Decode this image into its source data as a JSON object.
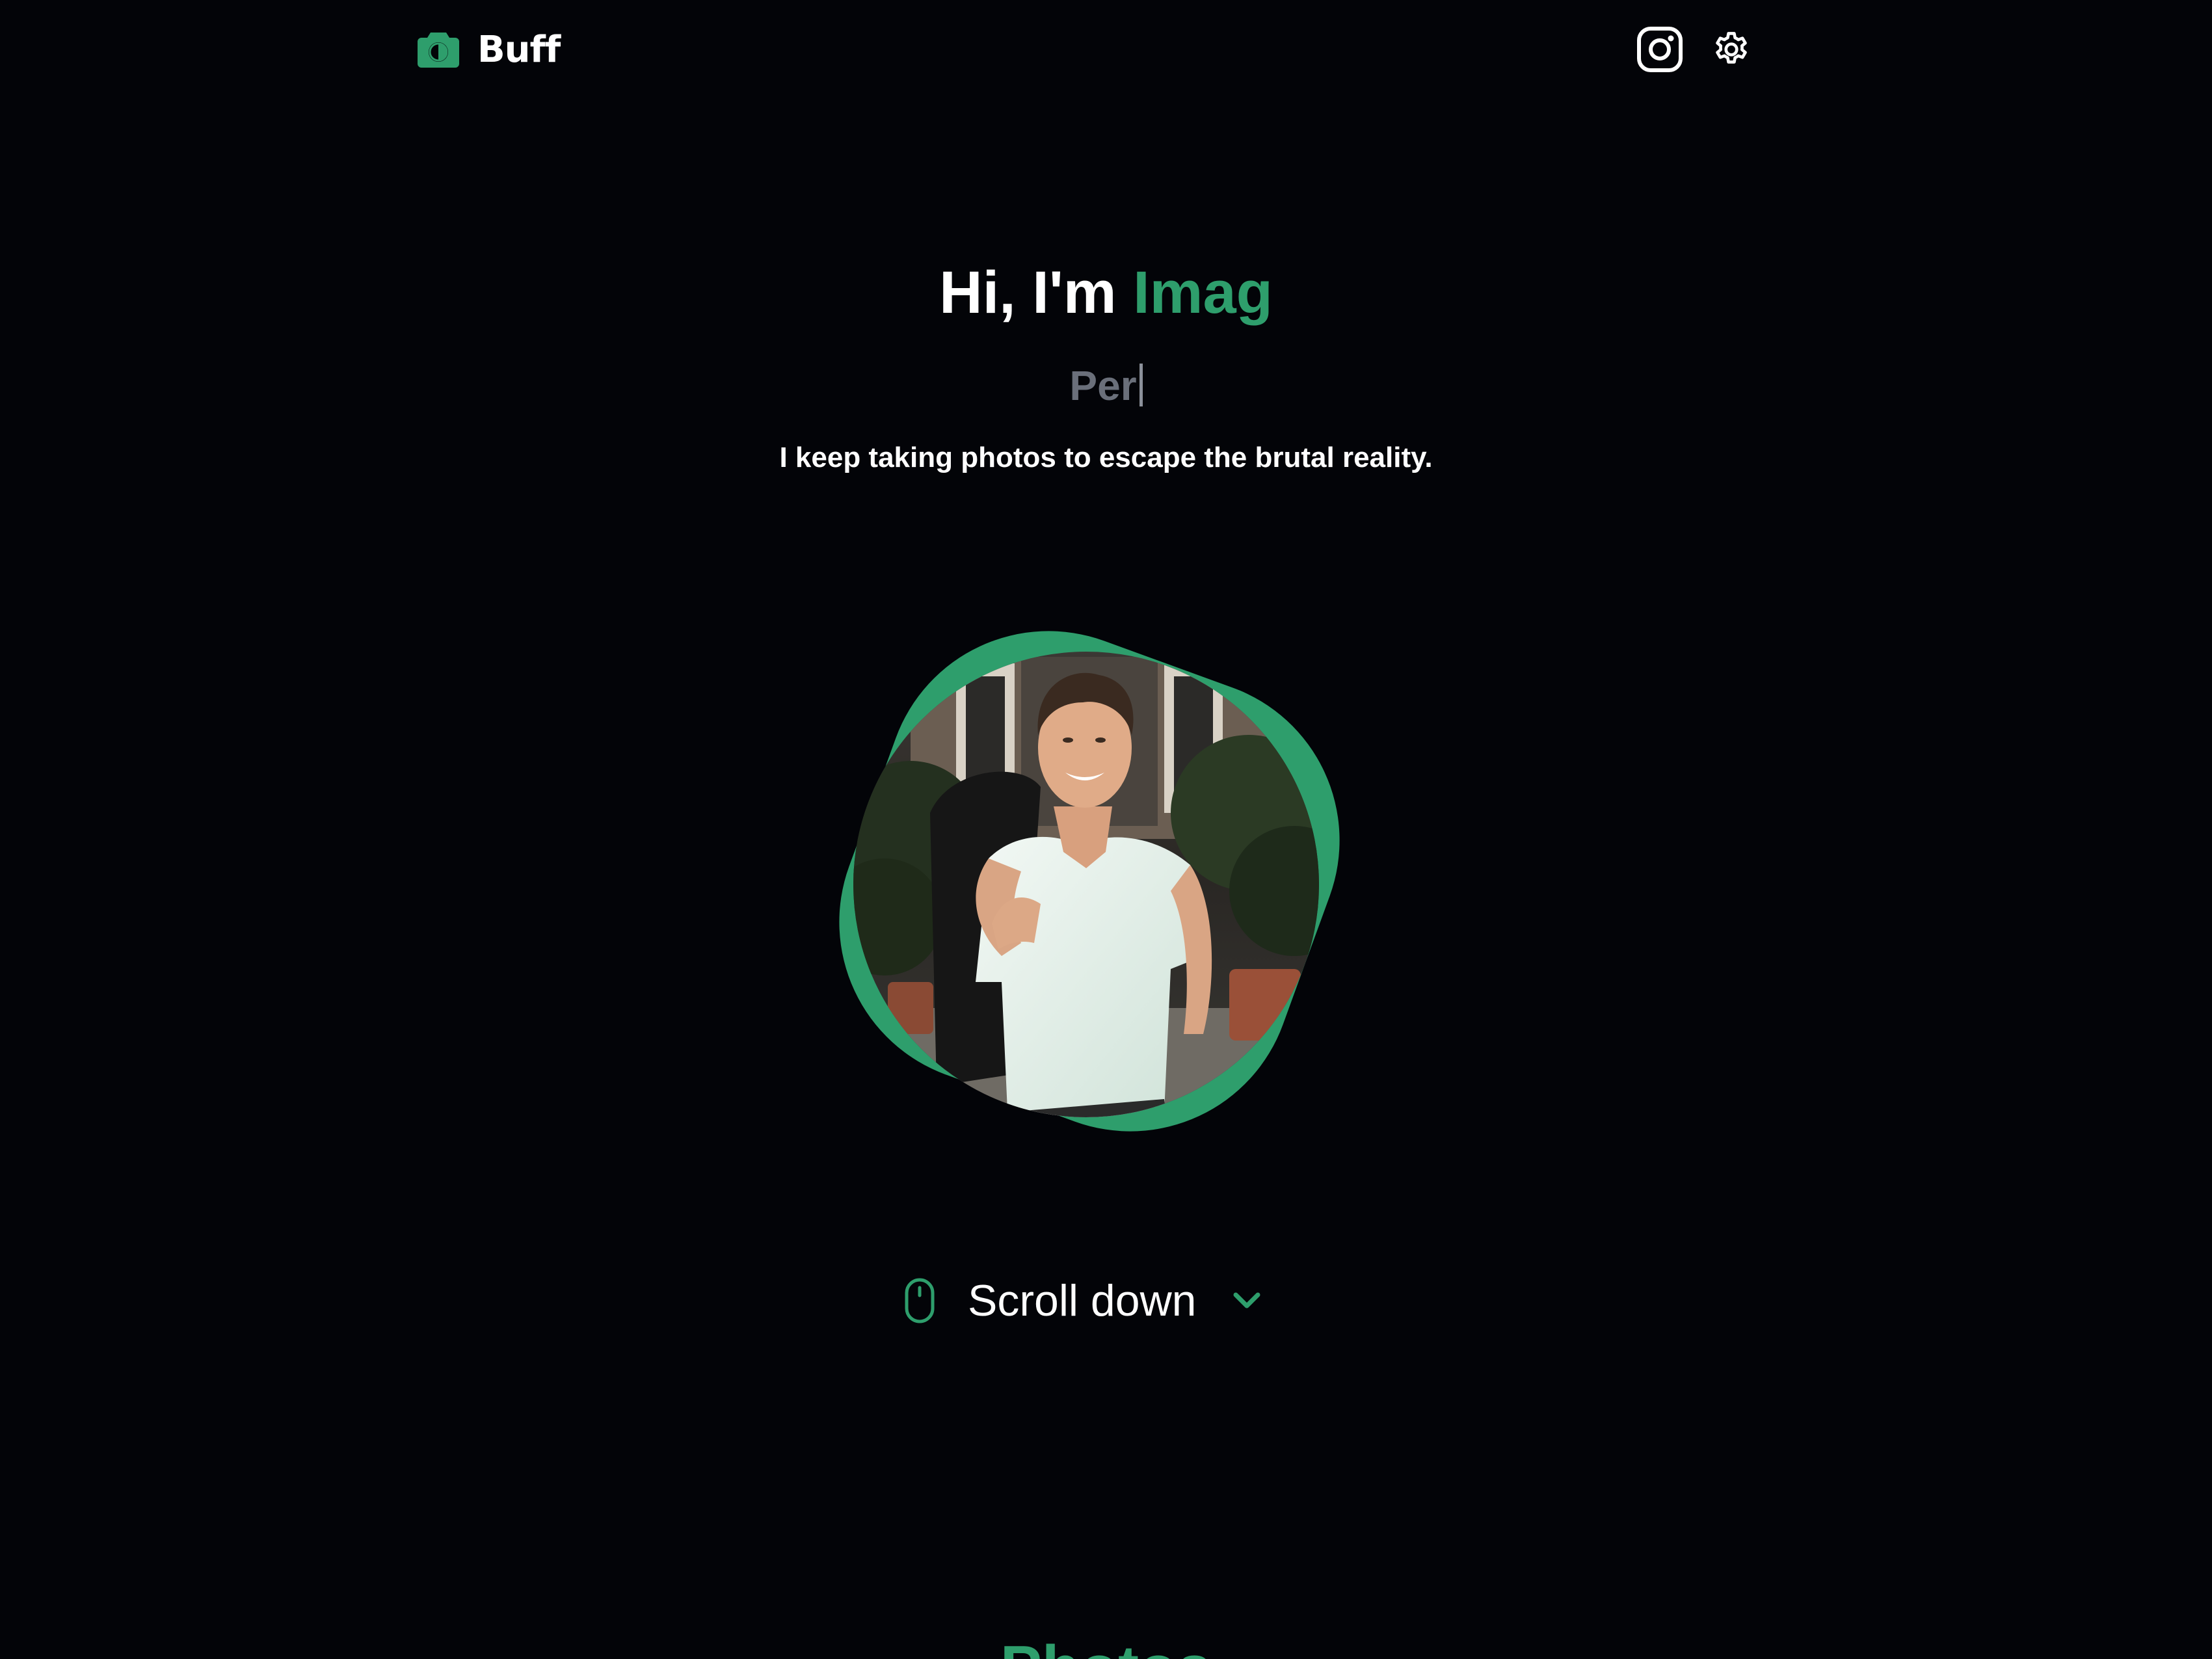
{
  "header": {
    "brand_name": "Buff",
    "brand_icon": "camera-icon",
    "actions": [
      {
        "icon": "instagram-icon"
      },
      {
        "icon": "gear-icon"
      }
    ]
  },
  "hero": {
    "greeting": "Hi, I'm ",
    "name": "Imag",
    "role_typed": "Per",
    "description": "I keep taking photos to escape the brutal reality.",
    "profile_image": "profile-photo"
  },
  "scroll": {
    "label": "Scroll down",
    "mouse_icon": "mouse-icon",
    "chevron_icon": "chevron-down-icon"
  },
  "sections": {
    "photos_title": "Photos"
  },
  "colors": {
    "background": "#030408",
    "accent": "#2e9e6c",
    "text": "#ffffff",
    "muted": "#6a6f7a"
  }
}
